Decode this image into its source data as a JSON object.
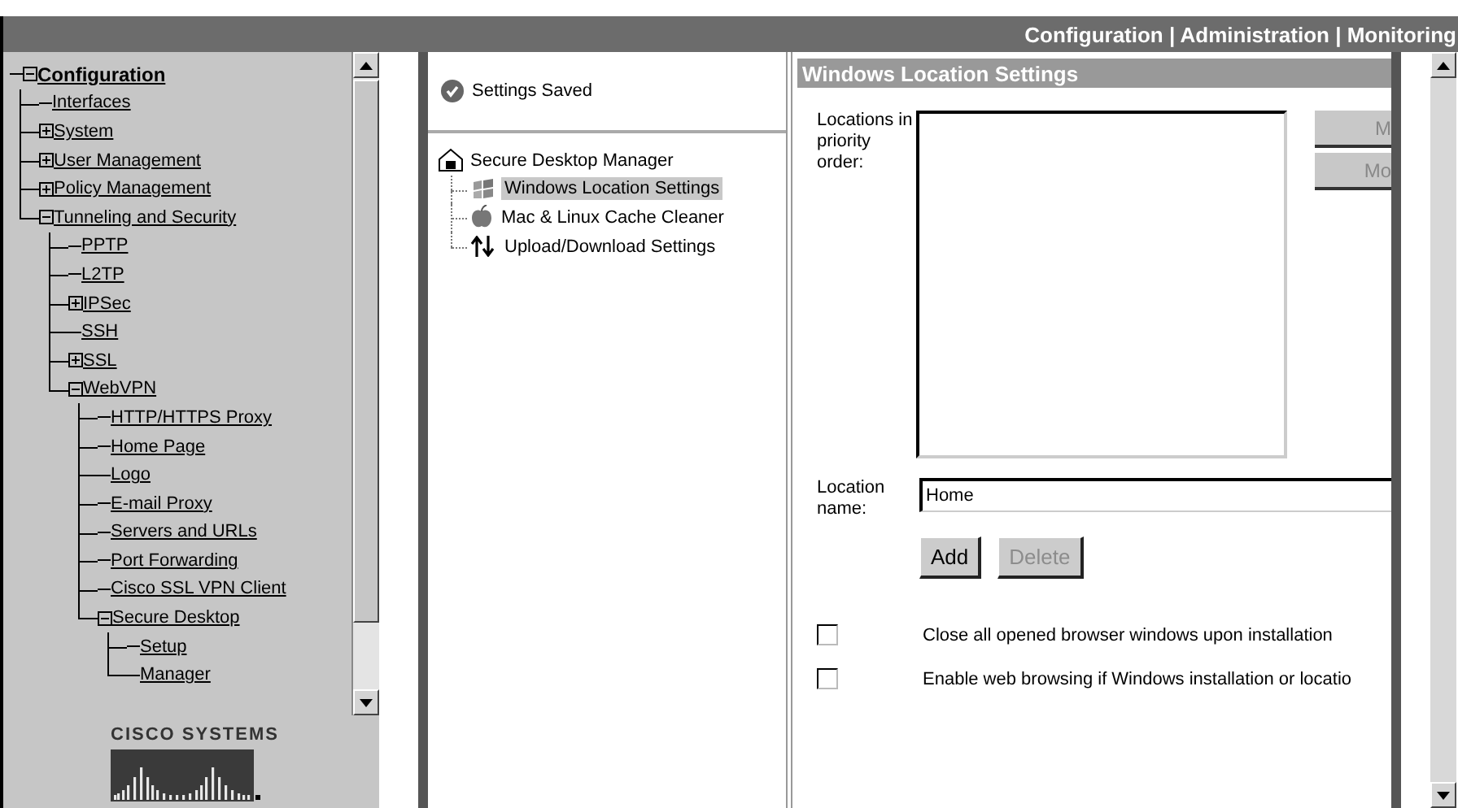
{
  "top_nav": "Configuration | Administration | Monitoring",
  "nav_tree": {
    "label": "Configuration",
    "expanded": true,
    "children": [
      {
        "label": "Interfaces"
      },
      {
        "label": "System",
        "expanded": false
      },
      {
        "label": "User Management",
        "expanded": false
      },
      {
        "label": "Policy Management",
        "expanded": false
      },
      {
        "label": "Tunneling and Security",
        "expanded": true,
        "children": [
          {
            "label": "PPTP"
          },
          {
            "label": "L2TP"
          },
          {
            "label": "IPSec",
            "expanded": false
          },
          {
            "label": "SSH"
          },
          {
            "label": "SSL",
            "expanded": false
          },
          {
            "label": "WebVPN",
            "expanded": true,
            "children": [
              {
                "label": "HTTP/HTTPS Proxy"
              },
              {
                "label": "Home Page"
              },
              {
                "label": "Logo"
              },
              {
                "label": "E-mail Proxy"
              },
              {
                "label": "Servers and URLs"
              },
              {
                "label": "Port Forwarding"
              },
              {
                "label": "Cisco SSL VPN Client"
              },
              {
                "label": "Secure Desktop",
                "expanded": true,
                "children": [
                  {
                    "label": "Setup"
                  },
                  {
                    "label": "Manager"
                  }
                ]
              }
            ]
          }
        ]
      }
    ]
  },
  "logo_text": "CISCO SYSTEMS",
  "status": "Settings Saved",
  "manager_tree": {
    "label": "Secure Desktop Manager",
    "children": [
      {
        "label": "Windows Location Settings",
        "kind": "windows",
        "selected": true
      },
      {
        "label": "Mac & Linux Cache Cleaner",
        "kind": "apple",
        "selected": false
      },
      {
        "label": "Upload/Download Settings",
        "kind": "arrows",
        "selected": false
      }
    ]
  },
  "panel": {
    "title": "Windows Location Settings",
    "locations_label": "Locations in priority order:",
    "move_buttons": [
      {
        "label": "M",
        "disabled": true
      },
      {
        "label": "Mo",
        "disabled": true
      }
    ],
    "name_label": "Location name:",
    "name_value": "Home",
    "buttons": [
      {
        "label": "Add",
        "disabled": false
      },
      {
        "label": "Delete",
        "disabled": true
      }
    ],
    "options": [
      {
        "label": "Close all opened browser windows upon installation",
        "checked": false
      },
      {
        "label": "Enable web browsing if Windows installation or locatio",
        "checked": false
      }
    ]
  }
}
